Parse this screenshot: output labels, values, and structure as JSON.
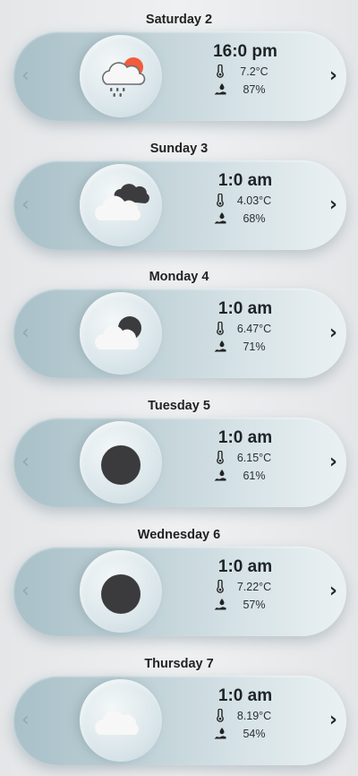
{
  "days": [
    {
      "title": "Saturday 2",
      "time": "16:0 pm",
      "temp": "7.2°C",
      "humidity": "87%",
      "icon": "cloud-sun-rain-icon"
    },
    {
      "title": "Sunday 3",
      "time": "1:0 am",
      "temp": "4.03°C",
      "humidity": "68%",
      "icon": "cloudy-night-icon"
    },
    {
      "title": "Monday 4",
      "time": "1:0 am",
      "temp": "6.47°C",
      "humidity": "71%",
      "icon": "cloud-moon-icon"
    },
    {
      "title": "Tuesday 5",
      "time": "1:0 am",
      "temp": "6.15°C",
      "humidity": "61%",
      "icon": "moon-icon"
    },
    {
      "title": "Wednesday 6",
      "time": "1:0 am",
      "temp": "7.22°C",
      "humidity": "57%",
      "icon": "moon-icon"
    },
    {
      "title": "Thursday 7",
      "time": "1:0 am",
      "temp": "8.19°C",
      "humidity": "54%",
      "icon": "cloud-icon"
    }
  ],
  "nav": {
    "prev": "‹",
    "next": "›"
  },
  "colors": {
    "sun": "#f25c3b",
    "moon": "#3b3b3d",
    "cloud_front": "#f7f7f7",
    "cloud_dark": "#3c3c3e",
    "rain": "#5c5f66",
    "card_left": "#a9c0c8",
    "card_right": "#eaf1f3"
  }
}
